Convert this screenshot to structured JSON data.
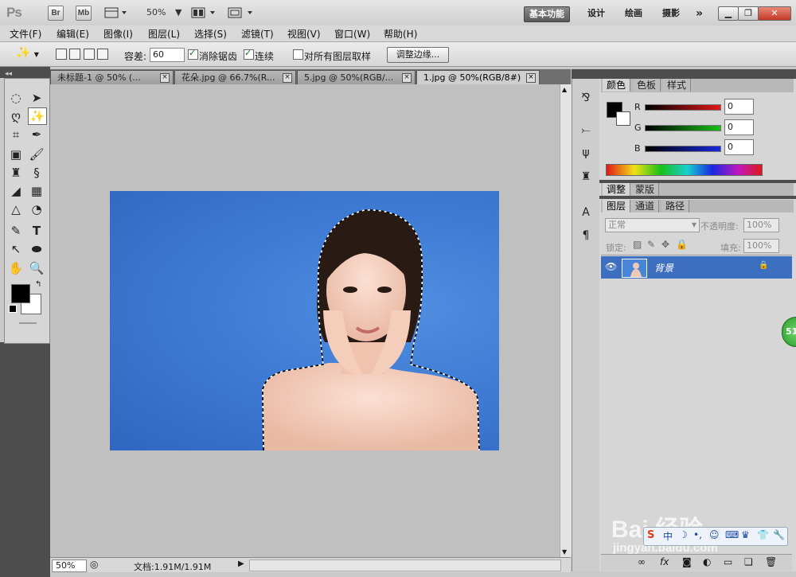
{
  "app": {
    "logo": "Ps",
    "bridge_btn": "Br",
    "minibridge_btn": "Mb",
    "zoom_level": "50%",
    "workspaces": [
      "基本功能",
      "设计",
      "绘画",
      "摄影"
    ],
    "more": "»"
  },
  "menu": {
    "items": [
      "文件(F)",
      "编辑(E)",
      "图像(I)",
      "图层(L)",
      "选择(S)",
      "滤镜(T)",
      "视图(V)",
      "窗口(W)",
      "帮助(H)"
    ]
  },
  "options": {
    "tolerance_label": "容差:",
    "tolerance_value": "60",
    "antialias_label": "消除锯齿",
    "antialias_checked": true,
    "contiguous_label": "连续",
    "contiguous_checked": true,
    "sample_all_label": "对所有图层取样",
    "sample_all_checked": false,
    "refine_edge_button": "调整边缘..."
  },
  "documents": {
    "tabs": [
      {
        "label": "未标题-1 @ 50% (...",
        "active": false
      },
      {
        "label": "花朵.jpg @ 66.7%(R...",
        "active": false
      },
      {
        "label": "5.jpg @ 50%(RGB/...",
        "active": false
      },
      {
        "label": "1.jpg @ 50%(RGB/8#)",
        "active": true
      }
    ]
  },
  "status": {
    "zoom": "50%",
    "doc_size": "文档:1.91M/1.91M"
  },
  "color_panel": {
    "tabs": [
      "颜色",
      "色板",
      "样式"
    ],
    "channels": [
      {
        "name": "R",
        "value": "0",
        "color": "#d42020"
      },
      {
        "name": "G",
        "value": "0",
        "color": "#20b020"
      },
      {
        "name": "B",
        "value": "0",
        "color": "#2030c8"
      }
    ]
  },
  "adjust_panel": {
    "tabs": [
      "调整",
      "蒙版"
    ]
  },
  "layers_panel": {
    "tabs": [
      "图层",
      "通道",
      "路径"
    ],
    "blend_mode": "正常",
    "opacity_label": "不透明度:",
    "opacity_value": "100%",
    "lock_label": "锁定:",
    "fill_label": "填充:",
    "fill_value": "100%",
    "layers": [
      {
        "name": "背景",
        "visible": true,
        "locked": true
      }
    ]
  },
  "watermark": {
    "brand": "Bai 经验",
    "url": "jingyan.baidu.com"
  },
  "badge": {
    "text": "51"
  }
}
